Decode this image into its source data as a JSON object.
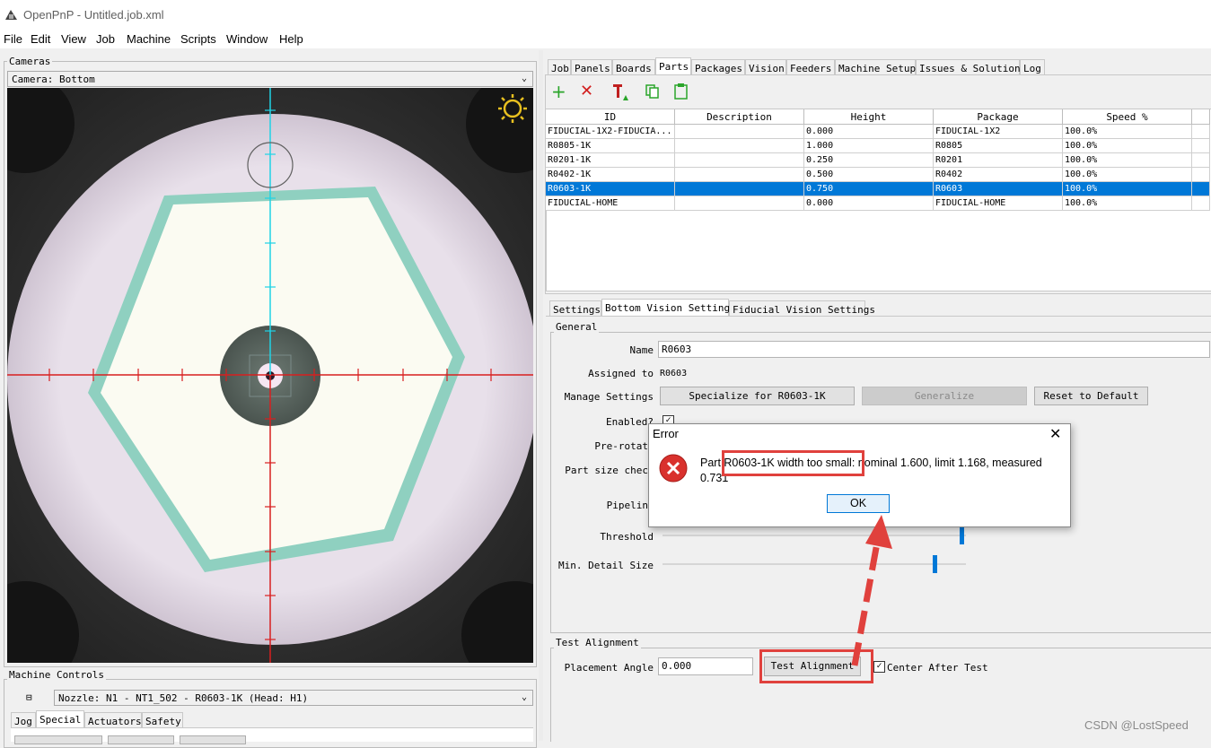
{
  "window": {
    "title": "OpenPnP - Untitled.job.xml"
  },
  "menu": [
    "File",
    "Edit",
    "View",
    "Job",
    "Machine",
    "Scripts",
    "Window",
    "Help"
  ],
  "cameras": {
    "group_label": "Cameras",
    "selected_camera": "Camera: Bottom"
  },
  "machine_controls": {
    "group_label": "Machine Controls",
    "nozzle": "Nozzle: N1 - NT1_502 - R0603-1K (Head: H1)",
    "tabs": [
      "Jog",
      "Special",
      "Actuators",
      "Safety"
    ],
    "selected_tab": "Special"
  },
  "main_tabs": [
    "Job",
    "Panels",
    "Boards",
    "Parts",
    "Packages",
    "Vision",
    "Feeders",
    "Machine Setup",
    "Issues & Solutions",
    "Log"
  ],
  "main_selected_tab": "Parts",
  "parts_table": {
    "columns": [
      "ID",
      "Description",
      "Height",
      "Package",
      "Speed %"
    ],
    "rows": [
      {
        "id": "FIDUCIAL-1X2-FIDUCIA...",
        "description": "",
        "height": "0.000",
        "package": "FIDUCIAL-1X2",
        "speed": "100.0%"
      },
      {
        "id": "R0805-1K",
        "description": "",
        "height": "1.000",
        "package": "R0805",
        "speed": "100.0%"
      },
      {
        "id": "R0201-1K",
        "description": "",
        "height": "0.250",
        "package": "R0201",
        "speed": "100.0%"
      },
      {
        "id": "R0402-1K",
        "description": "",
        "height": "0.500",
        "package": "R0402",
        "speed": "100.0%"
      },
      {
        "id": "R0603-1K",
        "description": "",
        "height": "0.750",
        "package": "R0603",
        "speed": "100.0%",
        "selected": true
      },
      {
        "id": "FIDUCIAL-HOME",
        "description": "",
        "height": "0.000",
        "package": "FIDUCIAL-HOME",
        "speed": "100.0%"
      }
    ]
  },
  "settings_tabs": [
    "Settings",
    "Bottom Vision Settings",
    "Fiducial Vision Settings"
  ],
  "settings_selected_tab": "Bottom Vision Settings",
  "general": {
    "group_label": "General",
    "name_label": "Name",
    "name_value": "R0603",
    "assigned_label": "Assigned to",
    "assigned_value": "R0603",
    "manage_label": "Manage Settings",
    "specialize_button": "Specialize for  R0603-1K",
    "generalize_button": "Generalize",
    "reset_button": "Reset to Default",
    "enabled_label": "Enabled?",
    "prerotate_label": "Pre-rotat",
    "partsize_label": "Part size chec",
    "pipeline_label": "Pipelin",
    "threshold_label": "Threshold",
    "threshold_value": 0.98,
    "min_detail_label": "Min. Detail Size",
    "min_detail_value": 0.89
  },
  "test_alignment": {
    "group_label": "Test Alignment",
    "placement_angle_label": "Placement Angle",
    "placement_angle_value": "0.000",
    "test_button": "Test Alignment",
    "center_after_test_label": "Center After Test",
    "center_after_test_checked": true
  },
  "dialog": {
    "title": "Error",
    "message_prefix": "Part ",
    "message_highlight": "R0603-1K width too small:",
    "message_suffix": " nominal 1.600, limit 1.168, measured 0.731",
    "ok_button": "OK"
  },
  "watermark": "CSDN @LostSpeed",
  "colors": {
    "selection": "#0078d7",
    "annotation_red": "#e0413d",
    "crosshair_red": "#d81f1f",
    "crosshair_cyan": "#1fd3e6"
  }
}
